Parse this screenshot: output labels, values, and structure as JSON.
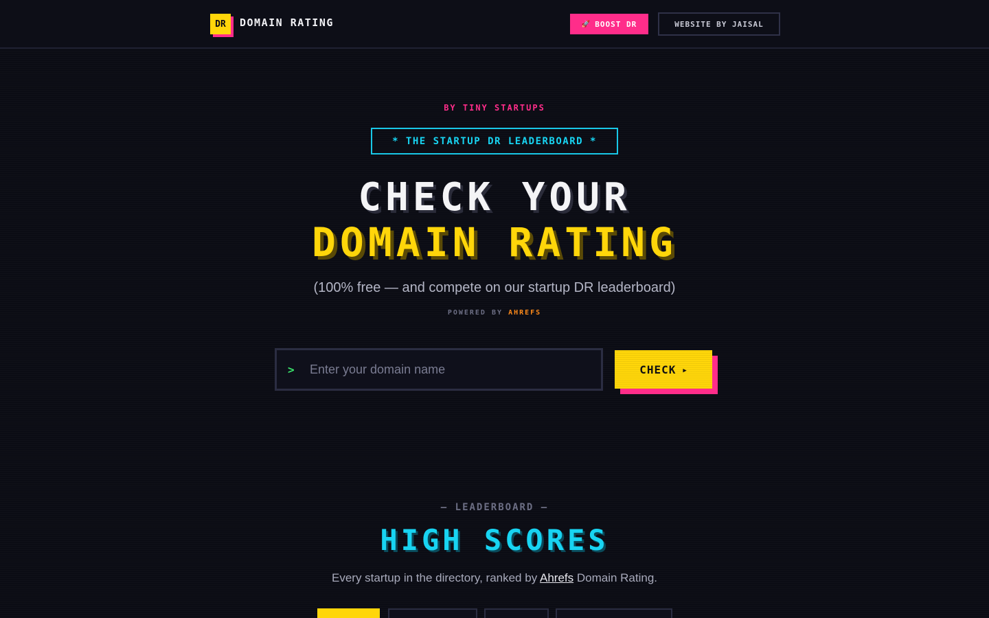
{
  "header": {
    "logo_mark": "DR",
    "logo_text": "DOMAIN RATING",
    "boost_icon": "rocket-icon",
    "boost_label": "BOOST DR",
    "website_label": "WEBSITE BY JAISAL"
  },
  "hero": {
    "byline": "BY TINY STARTUPS",
    "badge": "* THE STARTUP DR LEADERBOARD *",
    "headline_line1": "CHECK YOUR",
    "headline_line2": "DOMAIN RATING",
    "subtitle": "(100% free — and compete on our startup DR leaderboard)",
    "powered_prefix": "POWERED BY",
    "powered_brand": "AHREFS"
  },
  "search": {
    "prompt_icon": "chevron-right-icon",
    "placeholder": "Enter your domain name",
    "value": "",
    "button_label": "CHECK",
    "button_icon": "play-icon"
  },
  "leaderboard": {
    "kicker": "— LEADERBOARD —",
    "title": "HIGH SCORES",
    "desc_before": "Every startup in the directory, ranked by ",
    "desc_link": "Ahrefs",
    "desc_after": " Domain Rating."
  },
  "colors": {
    "background": "#0b0c14",
    "accent_yellow": "#ffd60a",
    "accent_pink": "#ff2d8a",
    "accent_cyan": "#18d4f2",
    "accent_green": "#3ae36b",
    "accent_orange": "#ff8a1a"
  }
}
